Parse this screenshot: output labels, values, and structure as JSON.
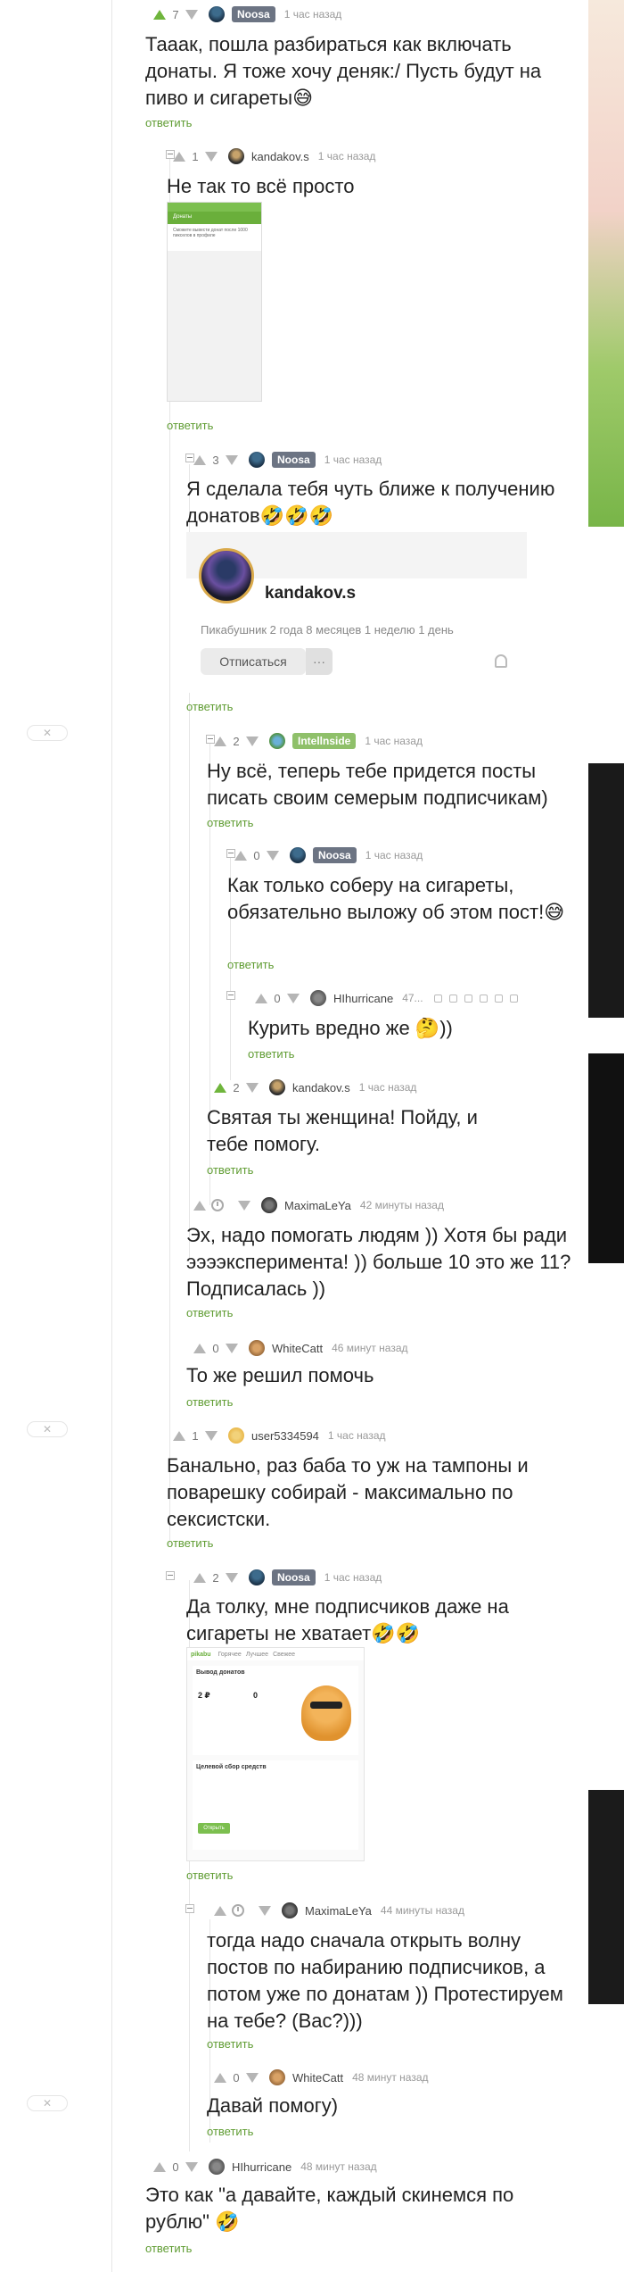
{
  "comments": [
    {
      "id": "c1",
      "votes": "7",
      "vote_active": true,
      "user": "Noosa",
      "badge": true,
      "time": "1 час назад",
      "text": "Тааак, пошла разбираться как включать донаты. Я тоже хочу деняк:/ Пусть будут на пиво и сигареты😅",
      "reply": "ответить"
    },
    {
      "id": "c2",
      "votes": "1",
      "vote_active": false,
      "user": "kandakov.s",
      "badge": false,
      "time": "1 час назад",
      "text": "Не так то всё просто",
      "reply": "ответить"
    },
    {
      "id": "c3",
      "votes": "3",
      "vote_active": false,
      "user": "Noosa",
      "badge": true,
      "time": "1 час назад",
      "text": "Я сделала тебя чуть ближе к получению донатов🤣🤣🤣",
      "reply": "ответить"
    },
    {
      "id": "c4",
      "votes": "2",
      "vote_active": false,
      "user": "Intellnside",
      "badge": true,
      "badge_green": true,
      "time": "1 час назад",
      "text": "Ну всё, теперь тебе придется посты писать своим семерым подписчикам)",
      "reply": "ответить"
    },
    {
      "id": "c5",
      "votes": "0",
      "vote_active": false,
      "user": "Noosa",
      "badge": true,
      "time": "1 час назад",
      "text": "Как только соберу на сигареты, обязательно выложу об этом пост!😅",
      "reply": "ответить"
    },
    {
      "id": "c6",
      "votes": "0",
      "vote_active": false,
      "user": "HIhurricane",
      "badge": false,
      "time": "47...",
      "text": "Курить вредно же 🤔))",
      "reply": "ответить"
    },
    {
      "id": "c7",
      "votes": "2",
      "vote_active": true,
      "user": "kandakov.s",
      "badge": false,
      "time": "1 час назад",
      "text": "Святая ты женщина! Пойду, и тебе помогу.",
      "reply": "ответить"
    },
    {
      "id": "c8",
      "votes": "",
      "vote_active": false,
      "user": "MaximaLeYa",
      "badge": false,
      "time": "42 минуты назад",
      "text": "Эх, надо помогать людям )) Хотя бы ради ээээксперимента! )) больше 10 это же 11? Подписалась ))",
      "reply": "ответить"
    },
    {
      "id": "c9",
      "votes": "0",
      "vote_active": false,
      "user": "WhiteCatt",
      "badge": false,
      "time": "46 минут назад",
      "text": "То же решил помочь",
      "reply": "ответить"
    },
    {
      "id": "c10",
      "votes": "1",
      "vote_active": false,
      "user": "user5334594",
      "badge": false,
      "time": "1 час назад",
      "text": "Банально, раз баба то уж на тампоны и поварешку собирай - максимально по сексистски.",
      "reply": "ответить"
    },
    {
      "id": "c11",
      "votes": "2",
      "vote_active": false,
      "user": "Noosa",
      "badge": true,
      "time": "1 час назад",
      "text": "Да толку, мне подписчиков даже на сигареты не хватает🤣🤣",
      "reply": "ответить"
    },
    {
      "id": "c12",
      "votes": "",
      "vote_active": false,
      "user": "MaximaLeYa",
      "badge": false,
      "time": "44 минуты назад",
      "text": "тогда надо сначала открыть волну постов по набиранию подписчиков, а потом уже по донатам )) Протестируем на тебе? (Вас?)))",
      "reply": "ответить"
    },
    {
      "id": "c13",
      "votes": "0",
      "vote_active": false,
      "user": "WhiteCatt",
      "badge": false,
      "time": "48 минут назад",
      "text": "Давай помогу)",
      "reply": "ответить"
    },
    {
      "id": "c14",
      "votes": "0",
      "vote_active": false,
      "user": "HIhurricane",
      "badge": false,
      "time": "48 минут назад",
      "text": "Это как \"а давайте, каждый скинемся по рублю\" 🤣",
      "reply": "ответить"
    }
  ],
  "profile_card": {
    "username": "kandakov.s",
    "stats": "Пикабушник 2 года 8 месяцев 1 неделю 1 день",
    "unsubscribe": "Отписаться",
    "more": "···"
  },
  "screenshot_thumb": {
    "header": "Донаты",
    "text": "Сможете вывести донат после 1000 пикселов в профиле"
  },
  "donate_screenshot": {
    "logo": "pikabu",
    "nav": [
      "Горячее",
      "Лучшее",
      "Свежее"
    ],
    "title": "Вывод донатов",
    "amount1": "2 ₽",
    "amount2": "0",
    "section": "Целевой сбор средств",
    "button": "Открыть"
  },
  "close_label": "✕",
  "colors": {
    "accent": "#5f9c32",
    "vote_active": "#6fb53c",
    "badge": "#6c7483",
    "badge_green": "#8fc06a"
  }
}
